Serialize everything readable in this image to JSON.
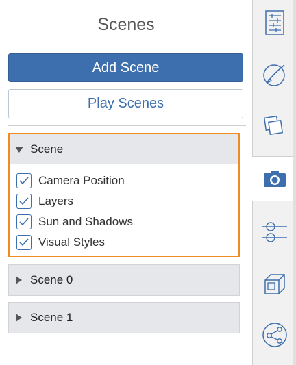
{
  "panel": {
    "title": "Scenes",
    "add_button": "Add Scene",
    "play_button": "Play Scenes"
  },
  "scenes": [
    {
      "name": "Scene",
      "expanded": true,
      "options": [
        {
          "label": "Camera Position",
          "checked": true
        },
        {
          "label": "Layers",
          "checked": true
        },
        {
          "label": "Sun and Shadows",
          "checked": true
        },
        {
          "label": "Visual Styles",
          "checked": true
        }
      ]
    },
    {
      "name": "Scene 0",
      "expanded": false
    },
    {
      "name": "Scene 1",
      "expanded": false
    }
  ],
  "sidebar": {
    "icons": [
      "entity-info-icon",
      "materials-icon",
      "components-icon",
      "scenes-icon",
      "styles-icon",
      "solid-tools-icon",
      "share-icon"
    ],
    "active": "scenes-icon"
  },
  "colors": {
    "accent": "#3d6fae",
    "selected_border": "#f08a24"
  }
}
